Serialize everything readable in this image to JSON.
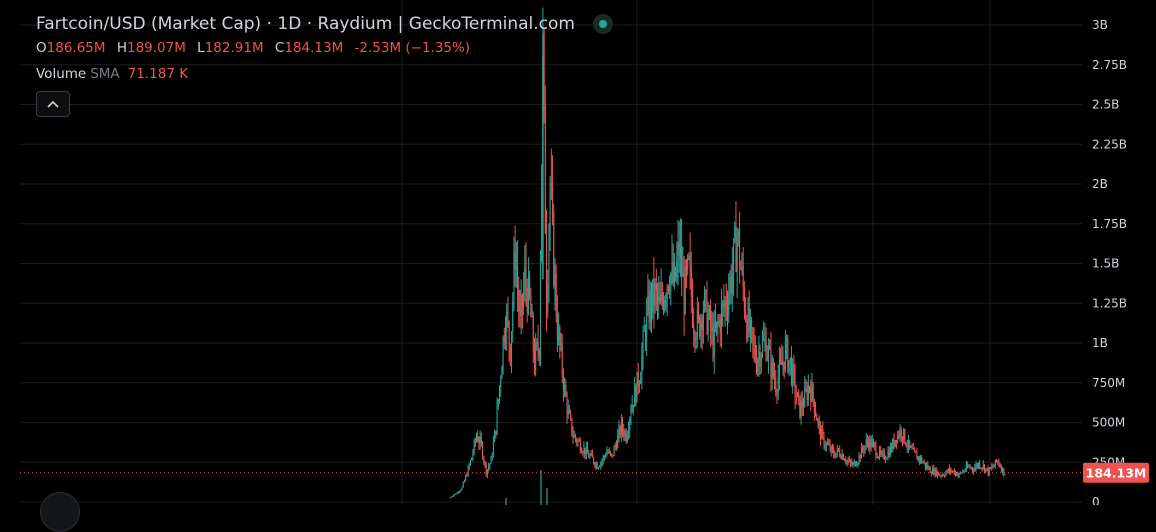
{
  "legend": {
    "title": "Fartcoin/USD (Market Cap) · 1D · Raydium | GeckoTerminal.com",
    "open_key": "O",
    "open_val": "186.65M",
    "high_key": "H",
    "high_val": "189.07M",
    "low_key": "L",
    "low_val": "182.91M",
    "close_key": "C",
    "close_val": "184.13M",
    "change": "-2.53M (−1.35%)",
    "volume_label": "Volume",
    "sma_label": "SMA",
    "sma_value": "71.187 K"
  },
  "icons": {
    "live": "live-status-dot-icon",
    "collapse": "chevron-up-icon"
  },
  "colors": {
    "background": "#000000",
    "up": "#26a69a",
    "down": "#ef5350",
    "grid": "#1c1c1c",
    "axis_text": "#d1d4dc",
    "price_tag": "#ef5350"
  },
  "chart_data": {
    "type": "candlestick",
    "title": "Fartcoin/USD (Market Cap) · 1D · Raydium | GeckoTerminal.com",
    "yaxis_ticks": [
      "0",
      "250M",
      "500M",
      "750M",
      "1B",
      "1.25B",
      "1.5B",
      "1.75B",
      "2B",
      "2.25B",
      "2.5B",
      "2.75B",
      "3B"
    ],
    "ylim": [
      0,
      3000000000
    ],
    "grid": true,
    "last_price_label": "184.13M",
    "last_price": 184130000,
    "points": [
      [
        0,
        30
      ],
      [
        6,
        60
      ],
      [
        10,
        90
      ],
      [
        14,
        180
      ],
      [
        18,
        280
      ],
      [
        22,
        420
      ],
      [
        26,
        350
      ],
      [
        30,
        190
      ],
      [
        34,
        260
      ],
      [
        38,
        470
      ],
      [
        42,
        820
      ],
      [
        46,
        1200
      ],
      [
        50,
        960
      ],
      [
        54,
        1600
      ],
      [
        58,
        1100
      ],
      [
        62,
        1400
      ],
      [
        66,
        1250
      ],
      [
        70,
        880
      ],
      [
        74,
        1000
      ],
      [
        77,
        2800
      ],
      [
        80,
        1300
      ],
      [
        83,
        2000
      ],
      [
        86,
        1500
      ],
      [
        89,
        1100
      ],
      [
        92,
        900
      ],
      [
        95,
        700
      ],
      [
        98,
        550
      ],
      [
        102,
        420
      ],
      [
        106,
        380
      ],
      [
        110,
        340
      ],
      [
        114,
        300
      ],
      [
        118,
        270
      ],
      [
        122,
        230
      ],
      [
        126,
        260
      ],
      [
        130,
        320
      ],
      [
        134,
        280
      ],
      [
        138,
        380
      ],
      [
        142,
        470
      ],
      [
        146,
        420
      ],
      [
        150,
        600
      ],
      [
        154,
        700
      ],
      [
        158,
        850
      ],
      [
        162,
        1100
      ],
      [
        166,
        1250
      ],
      [
        170,
        1300
      ],
      [
        174,
        1200
      ],
      [
        178,
        1350
      ],
      [
        182,
        1460
      ],
      [
        186,
        1350
      ],
      [
        190,
        1600
      ],
      [
        194,
        1300
      ],
      [
        198,
        1450
      ],
      [
        202,
        1150
      ],
      [
        206,
        1100
      ],
      [
        210,
        1250
      ],
      [
        214,
        1150
      ],
      [
        218,
        1000
      ],
      [
        222,
        1100
      ],
      [
        226,
        1200
      ],
      [
        230,
        1300
      ],
      [
        234,
        1450
      ],
      [
        238,
        1680
      ],
      [
        242,
        1400
      ],
      [
        246,
        1150
      ],
      [
        250,
        1000
      ],
      [
        254,
        900
      ],
      [
        258,
        980
      ],
      [
        262,
        1000
      ],
      [
        266,
        850
      ],
      [
        270,
        750
      ],
      [
        274,
        830
      ],
      [
        278,
        950
      ],
      [
        282,
        870
      ],
      [
        286,
        700
      ],
      [
        290,
        580
      ],
      [
        294,
        650
      ],
      [
        298,
        740
      ],
      [
        302,
        620
      ],
      [
        306,
        450
      ],
      [
        310,
        380
      ],
      [
        314,
        340
      ],
      [
        318,
        300
      ],
      [
        322,
        320
      ],
      [
        326,
        290
      ],
      [
        330,
        250
      ],
      [
        334,
        230
      ],
      [
        338,
        270
      ],
      [
        342,
        330
      ],
      [
        346,
        380
      ],
      [
        350,
        360
      ],
      [
        354,
        310
      ],
      [
        358,
        280
      ],
      [
        362,
        300
      ],
      [
        366,
        340
      ],
      [
        370,
        420
      ],
      [
        374,
        450
      ],
      [
        378,
        380
      ],
      [
        382,
        320
      ],
      [
        386,
        290
      ],
      [
        390,
        270
      ],
      [
        394,
        230
      ],
      [
        398,
        200
      ],
      [
        402,
        190
      ],
      [
        406,
        170
      ],
      [
        410,
        180
      ],
      [
        414,
        200
      ],
      [
        418,
        190
      ],
      [
        422,
        170
      ],
      [
        426,
        200
      ],
      [
        430,
        220
      ],
      [
        434,
        210
      ],
      [
        438,
        240
      ],
      [
        442,
        225
      ],
      [
        446,
        190
      ],
      [
        450,
        220
      ],
      [
        454,
        260
      ],
      [
        458,
        200
      ],
      [
        460,
        184
      ]
    ],
    "points_encoding": "pairs of [bar_index, market_cap_in_millions_usd]"
  }
}
